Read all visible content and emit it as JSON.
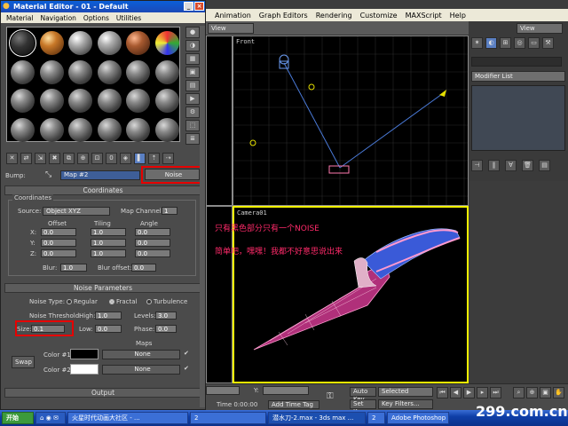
{
  "material_editor": {
    "title": "Material Editor - 01 - Default",
    "menu": [
      "Material",
      "Navigation",
      "Options",
      "Utilities"
    ],
    "bump_label": "Bump:",
    "map_name": "Map #2",
    "map_type_button": "Noise",
    "coordinates": {
      "header": "Coordinates",
      "group_label": "Coordinates",
      "source_label": "Source:",
      "source_value": "Object XYZ",
      "map_channel_label": "Map Channel:",
      "map_channel_value": "1",
      "columns": [
        "Offset",
        "Tiling",
        "Angle"
      ],
      "rows": [
        {
          "axis": "X:",
          "offset": "0.0",
          "tiling": "1.0",
          "angle": "0.0"
        },
        {
          "axis": "Y:",
          "offset": "0.0",
          "tiling": "1.0",
          "angle": "0.0"
        },
        {
          "axis": "Z:",
          "offset": "0.0",
          "tiling": "1.0",
          "angle": "0.0"
        }
      ],
      "blur_label": "Blur:",
      "blur_value": "1.0",
      "blur_offset_label": "Blur offset:",
      "blur_offset_value": "0.0"
    },
    "noise": {
      "header": "Noise Parameters",
      "type_label": "Noise Type:",
      "types": [
        "Regular",
        "Fractal",
        "Turbulence"
      ],
      "threshold_label": "Noise Threshold:",
      "high_label": "High:",
      "high_value": "1.0",
      "levels_label": "Levels:",
      "levels_value": "3.0",
      "size_label": "Size:",
      "size_value": "0.1",
      "low_label": "Low:",
      "low_value": "0.0",
      "phase_label": "Phase:",
      "phase_value": "0.0",
      "maps_label": "Maps",
      "swap_label": "Swap",
      "color1_label": "Color #1",
      "color2_label": "Color #2",
      "map1": "None",
      "map2": "None",
      "color1": "#000000",
      "color2": "#ffffff"
    },
    "output_header": "Output"
  },
  "max_menu": [
    "Animation",
    "Graph Editors",
    "Rendering",
    "Customize",
    "MAXScript",
    "Help"
  ],
  "view_dropdown": "View",
  "view_dropdown2": "View",
  "viewports": {
    "front_label": "Front",
    "camera_label": "Camera01"
  },
  "command_panel": {
    "modifier_list": "Modifier List"
  },
  "status": {
    "y_label": "Y:",
    "time_label": "Time 0:00:00",
    "auto_key": "Auto Key",
    "selected": "Selected",
    "set_key": "Set Key",
    "key_filters": "Key Filters...",
    "add_time_tag": "Add Time Tag"
  },
  "annotation": {
    "line1": "只有黑色部分只有一个NOISE",
    "line2": "简单吧，嘿嘿！我都不好意思说出来"
  },
  "watermark": "299.com.cn",
  "taskbar": {
    "start": "开始",
    "items": [
      "火星时代动画大社区 - ...",
      "2",
      "潜水刀-2.max - 3ds max ...",
      "2",
      "Adobe Photoshop"
    ]
  }
}
